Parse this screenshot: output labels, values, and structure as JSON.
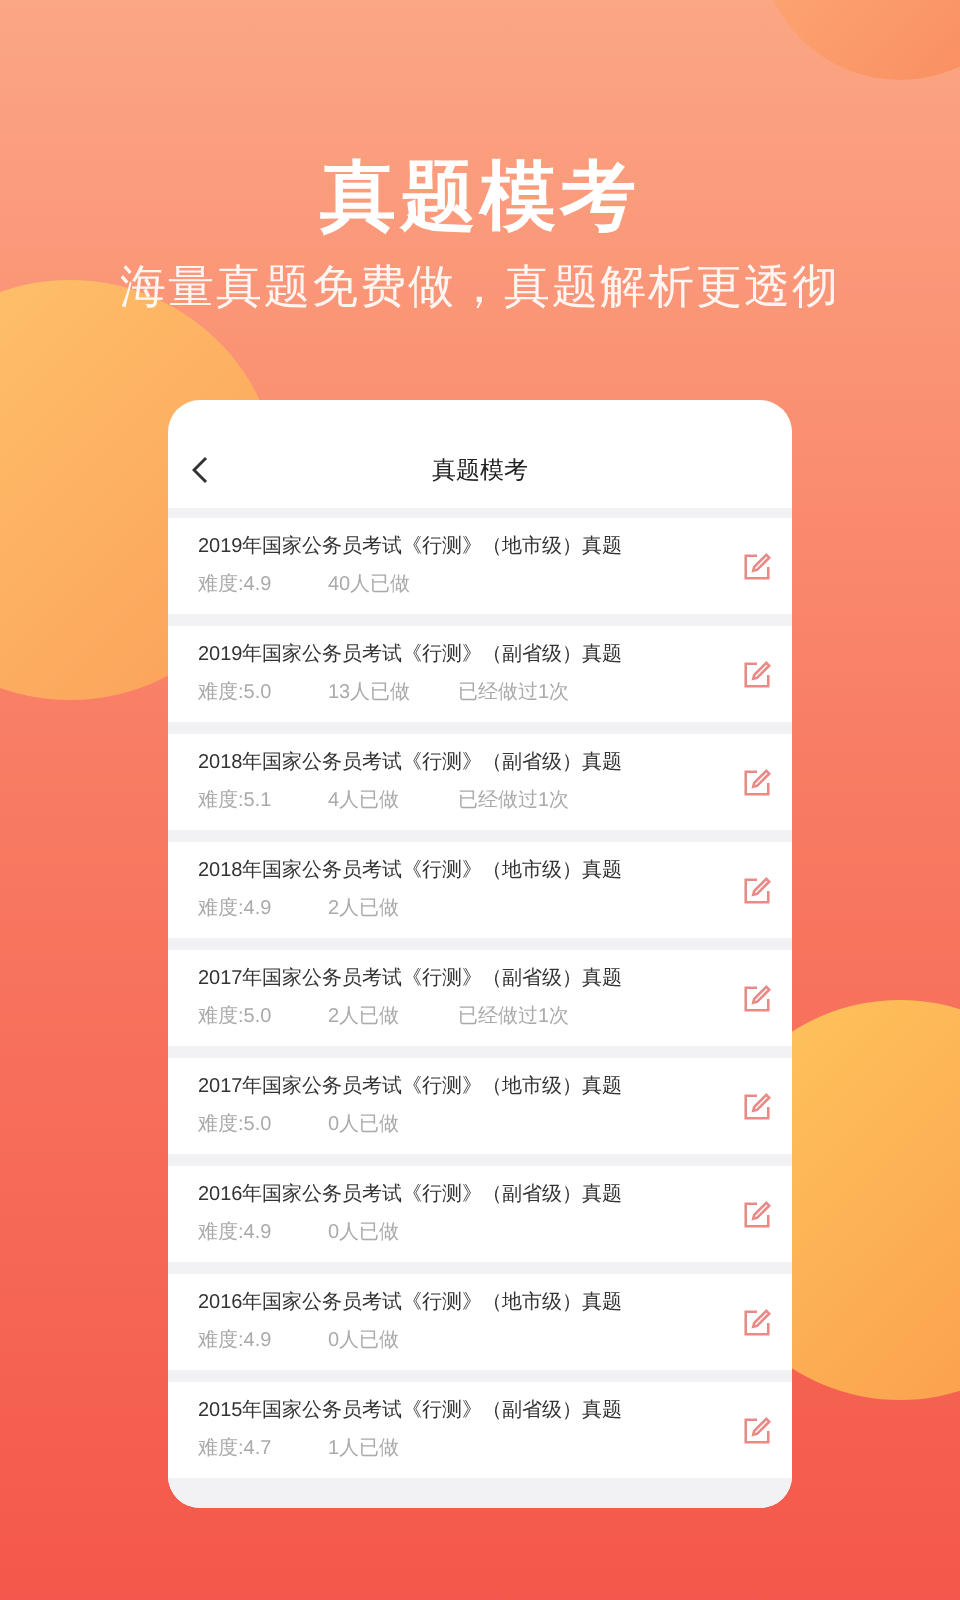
{
  "headline": "真题模考",
  "subheadline": "海量真题免费做，真题解析更透彻",
  "screen": {
    "title": "真题模考"
  },
  "items": [
    {
      "title": "2019年国家公务员考试《行测》（地市级）真题",
      "difficulty": "难度:4.9",
      "done_count": "40人已做"
    },
    {
      "title": "2019年国家公务员考试《行测》（副省级）真题",
      "difficulty": "难度:5.0",
      "done_count": "13人已做",
      "attempt_note": "已经做过1次"
    },
    {
      "title": "2018年国家公务员考试《行测》（副省级）真题",
      "difficulty": "难度:5.1",
      "done_count": "4人已做",
      "attempt_note": "已经做过1次"
    },
    {
      "title": "2018年国家公务员考试《行测》（地市级）真题",
      "difficulty": "难度:4.9",
      "done_count": "2人已做"
    },
    {
      "title": "2017年国家公务员考试《行测》（副省级）真题",
      "difficulty": "难度:5.0",
      "done_count": "2人已做",
      "attempt_note": "已经做过1次"
    },
    {
      "title": "2017年国家公务员考试《行测》（地市级）真题",
      "difficulty": "难度:5.0",
      "done_count": "0人已做"
    },
    {
      "title": "2016年国家公务员考试《行测》（副省级）真题",
      "difficulty": "难度:4.9",
      "done_count": "0人已做"
    },
    {
      "title": "2016年国家公务员考试《行测》（地市级）真题",
      "difficulty": "难度:4.9",
      "done_count": "0人已做"
    },
    {
      "title": "2015年国家公务员考试《行测》（副省级）真题",
      "difficulty": "难度:4.7",
      "done_count": "1人已做"
    }
  ]
}
